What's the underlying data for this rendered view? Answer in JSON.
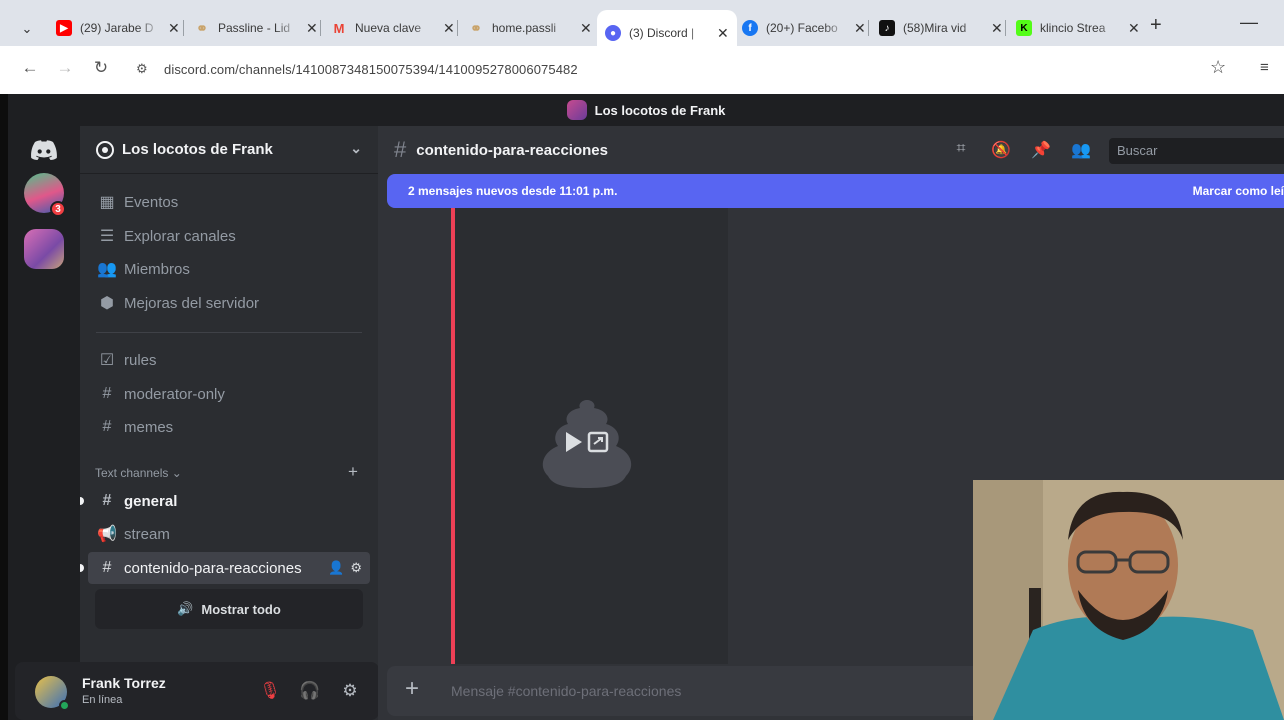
{
  "browser": {
    "tabs": [
      {
        "title": "(29) Jarabe D",
        "fav_color": "#ff0000",
        "fav_char": "▶"
      },
      {
        "title": "Passline - Lid",
        "fav_color": "#c9a36a",
        "fav_char": "∞"
      },
      {
        "title": "Nueva clave",
        "fav_color": "#ea4335",
        "fav_char": "M"
      },
      {
        "title": "home.passli",
        "fav_color": "#c9a36a",
        "fav_char": "∞"
      },
      {
        "title": "(3) Discord |",
        "fav_color": "#5865f2",
        "fav_char": "●"
      },
      {
        "title": "(20+) Facebo",
        "fav_color": "#1877f2",
        "fav_char": "f"
      },
      {
        "title": "(58)Mira vid",
        "fav_color": "#111111",
        "fav_char": "♪"
      },
      {
        "title": "klincio Strea",
        "fav_color": "#53fc18",
        "fav_char": "K"
      }
    ],
    "url": "discord.com/channels/1410087348150075394/1410095278006075482"
  },
  "discord": {
    "window_title": "Los locotos de Frank",
    "server_name": "Los locotos de Frank",
    "notification_badge": "3",
    "nav_items": [
      {
        "label": "Eventos",
        "icon": "calendar-icon"
      },
      {
        "label": "Explorar canales",
        "icon": "browse-channels-icon"
      },
      {
        "label": "Miembros",
        "icon": "members-icon"
      },
      {
        "label": "Mejoras del servidor",
        "icon": "boost-icon"
      }
    ],
    "channels_top": [
      {
        "label": "rules",
        "icon": "rules-icon"
      },
      {
        "label": "moderator-only",
        "icon": "hash-icon"
      },
      {
        "label": "memes",
        "icon": "hash-icon"
      }
    ],
    "category": "Text channels",
    "channels_text": [
      {
        "label": "general",
        "icon": "hash-icon"
      },
      {
        "label": "stream",
        "icon": "announcement-icon"
      },
      {
        "label": "contenido-para-reacciones",
        "icon": "hash-icon"
      }
    ],
    "show_all": "Mostrar todo",
    "user": {
      "name": "Frank Torrez",
      "status": "En línea"
    },
    "channel_header": "contenido-para-reacciones",
    "search_placeholder": "Buscar",
    "new_messages": "2 mensajes nuevos desde 11:01 p.m.",
    "mark_read": "Marcar como leí",
    "message_placeholder": "Mensaje #contenido-para-reacciones"
  },
  "colors": {
    "accent": "#5865f2",
    "danger": "#ed4056",
    "online": "#23a55a"
  }
}
